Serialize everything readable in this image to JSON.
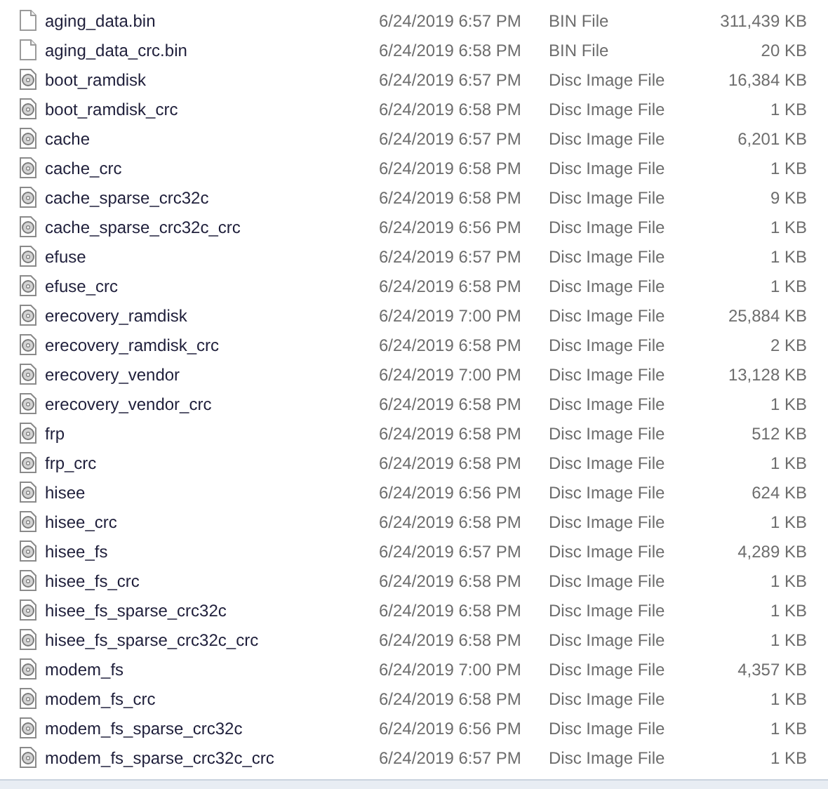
{
  "files": [
    {
      "name": "aging_data.bin",
      "date": "6/24/2019 6:57 PM",
      "type": "BIN File",
      "size": "311,439 KB",
      "kind": "blank"
    },
    {
      "name": "aging_data_crc.bin",
      "date": "6/24/2019 6:58 PM",
      "type": "BIN File",
      "size": "20 KB",
      "kind": "blank"
    },
    {
      "name": "boot_ramdisk",
      "date": "6/24/2019 6:57 PM",
      "type": "Disc Image File",
      "size": "16,384 KB",
      "kind": "disc"
    },
    {
      "name": "boot_ramdisk_crc",
      "date": "6/24/2019 6:58 PM",
      "type": "Disc Image File",
      "size": "1 KB",
      "kind": "disc"
    },
    {
      "name": "cache",
      "date": "6/24/2019 6:57 PM",
      "type": "Disc Image File",
      "size": "6,201 KB",
      "kind": "disc"
    },
    {
      "name": "cache_crc",
      "date": "6/24/2019 6:58 PM",
      "type": "Disc Image File",
      "size": "1 KB",
      "kind": "disc"
    },
    {
      "name": "cache_sparse_crc32c",
      "date": "6/24/2019 6:58 PM",
      "type": "Disc Image File",
      "size": "9 KB",
      "kind": "disc"
    },
    {
      "name": "cache_sparse_crc32c_crc",
      "date": "6/24/2019 6:56 PM",
      "type": "Disc Image File",
      "size": "1 KB",
      "kind": "disc"
    },
    {
      "name": "efuse",
      "date": "6/24/2019 6:57 PM",
      "type": "Disc Image File",
      "size": "1 KB",
      "kind": "disc"
    },
    {
      "name": "efuse_crc",
      "date": "6/24/2019 6:58 PM",
      "type": "Disc Image File",
      "size": "1 KB",
      "kind": "disc"
    },
    {
      "name": "erecovery_ramdisk",
      "date": "6/24/2019 7:00 PM",
      "type": "Disc Image File",
      "size": "25,884 KB",
      "kind": "disc"
    },
    {
      "name": "erecovery_ramdisk_crc",
      "date": "6/24/2019 6:58 PM",
      "type": "Disc Image File",
      "size": "2 KB",
      "kind": "disc"
    },
    {
      "name": "erecovery_vendor",
      "date": "6/24/2019 7:00 PM",
      "type": "Disc Image File",
      "size": "13,128 KB",
      "kind": "disc"
    },
    {
      "name": "erecovery_vendor_crc",
      "date": "6/24/2019 6:58 PM",
      "type": "Disc Image File",
      "size": "1 KB",
      "kind": "disc"
    },
    {
      "name": "frp",
      "date": "6/24/2019 6:58 PM",
      "type": "Disc Image File",
      "size": "512 KB",
      "kind": "disc"
    },
    {
      "name": "frp_crc",
      "date": "6/24/2019 6:58 PM",
      "type": "Disc Image File",
      "size": "1 KB",
      "kind": "disc"
    },
    {
      "name": "hisee",
      "date": "6/24/2019 6:56 PM",
      "type": "Disc Image File",
      "size": "624 KB",
      "kind": "disc"
    },
    {
      "name": "hisee_crc",
      "date": "6/24/2019 6:58 PM",
      "type": "Disc Image File",
      "size": "1 KB",
      "kind": "disc"
    },
    {
      "name": "hisee_fs",
      "date": "6/24/2019 6:57 PM",
      "type": "Disc Image File",
      "size": "4,289 KB",
      "kind": "disc"
    },
    {
      "name": "hisee_fs_crc",
      "date": "6/24/2019 6:58 PM",
      "type": "Disc Image File",
      "size": "1 KB",
      "kind": "disc"
    },
    {
      "name": "hisee_fs_sparse_crc32c",
      "date": "6/24/2019 6:58 PM",
      "type": "Disc Image File",
      "size": "1 KB",
      "kind": "disc"
    },
    {
      "name": "hisee_fs_sparse_crc32c_crc",
      "date": "6/24/2019 6:58 PM",
      "type": "Disc Image File",
      "size": "1 KB",
      "kind": "disc"
    },
    {
      "name": "modem_fs",
      "date": "6/24/2019 7:00 PM",
      "type": "Disc Image File",
      "size": "4,357 KB",
      "kind": "disc"
    },
    {
      "name": "modem_fs_crc",
      "date": "6/24/2019 6:58 PM",
      "type": "Disc Image File",
      "size": "1 KB",
      "kind": "disc"
    },
    {
      "name": "modem_fs_sparse_crc32c",
      "date": "6/24/2019 6:56 PM",
      "type": "Disc Image File",
      "size": "1 KB",
      "kind": "disc"
    },
    {
      "name": "modem_fs_sparse_crc32c_crc",
      "date": "6/24/2019 6:57 PM",
      "type": "Disc Image File",
      "size": "1 KB",
      "kind": "disc"
    }
  ]
}
